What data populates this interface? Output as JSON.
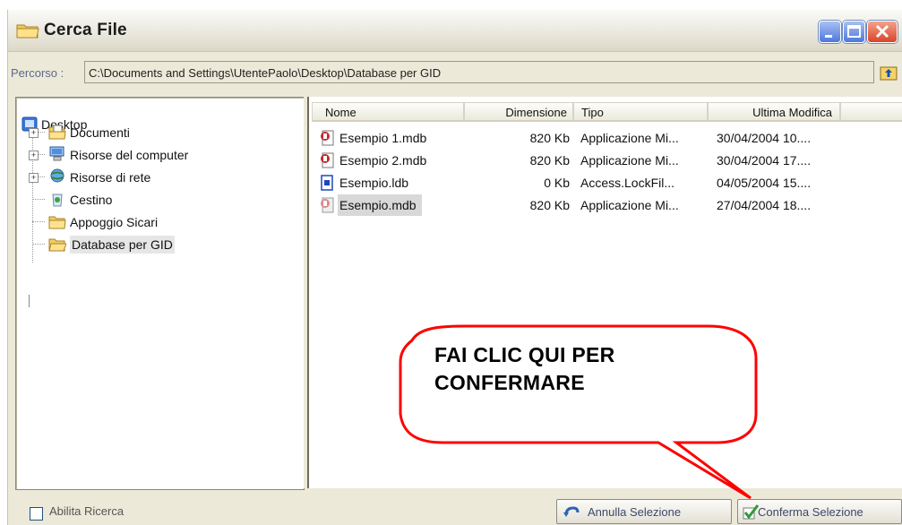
{
  "window": {
    "title": "Cerca File"
  },
  "path": {
    "label": "Percorso :",
    "value": "C:\\Documents and Settings\\UtentePaolo\\Desktop\\Database per GID"
  },
  "tree": {
    "root": "Desktop",
    "items": [
      {
        "label": "Documenti",
        "icon": "documents-folder-icon"
      },
      {
        "label": "Risorse del computer",
        "icon": "computer-icon"
      },
      {
        "label": "Risorse di rete",
        "icon": "network-icon"
      },
      {
        "label": "Cestino",
        "icon": "recycle-bin-icon"
      },
      {
        "label": "Appoggio Sicari",
        "icon": "folder-icon"
      },
      {
        "label": "Database per GID",
        "icon": "folder-open-icon"
      }
    ]
  },
  "files": {
    "columns": [
      "Nome",
      "Dimensione",
      "Tipo",
      "Ultima Modifica"
    ],
    "rows": [
      {
        "name": "Esempio 1.mdb",
        "size": "820 Kb",
        "type": "Applicazione Mi...",
        "modified": "30/04/2004 10...."
      },
      {
        "name": "Esempio 2.mdb",
        "size": "820 Kb",
        "type": "Applicazione Mi...",
        "modified": "30/04/2004 17...."
      },
      {
        "name": "Esempio.ldb",
        "size": "0 Kb",
        "type": "Access.LockFil...",
        "modified": "04/05/2004 15...."
      },
      {
        "name": "Esempio.mdb",
        "size": "820 Kb",
        "type": "Applicazione Mi...",
        "modified": "27/04/2004 18...."
      }
    ]
  },
  "bottom": {
    "enable_search_label": "Abilita Ricerca",
    "cancel_label": "Annulla Selezione",
    "confirm_label": "Conferma Selezione"
  },
  "callout": {
    "line1": "FAI CLIC QUI PER",
    "line2": "CONFERMARE"
  },
  "colors": {
    "callout_stroke": "#ff0000",
    "selection": "#d8d8d8"
  }
}
